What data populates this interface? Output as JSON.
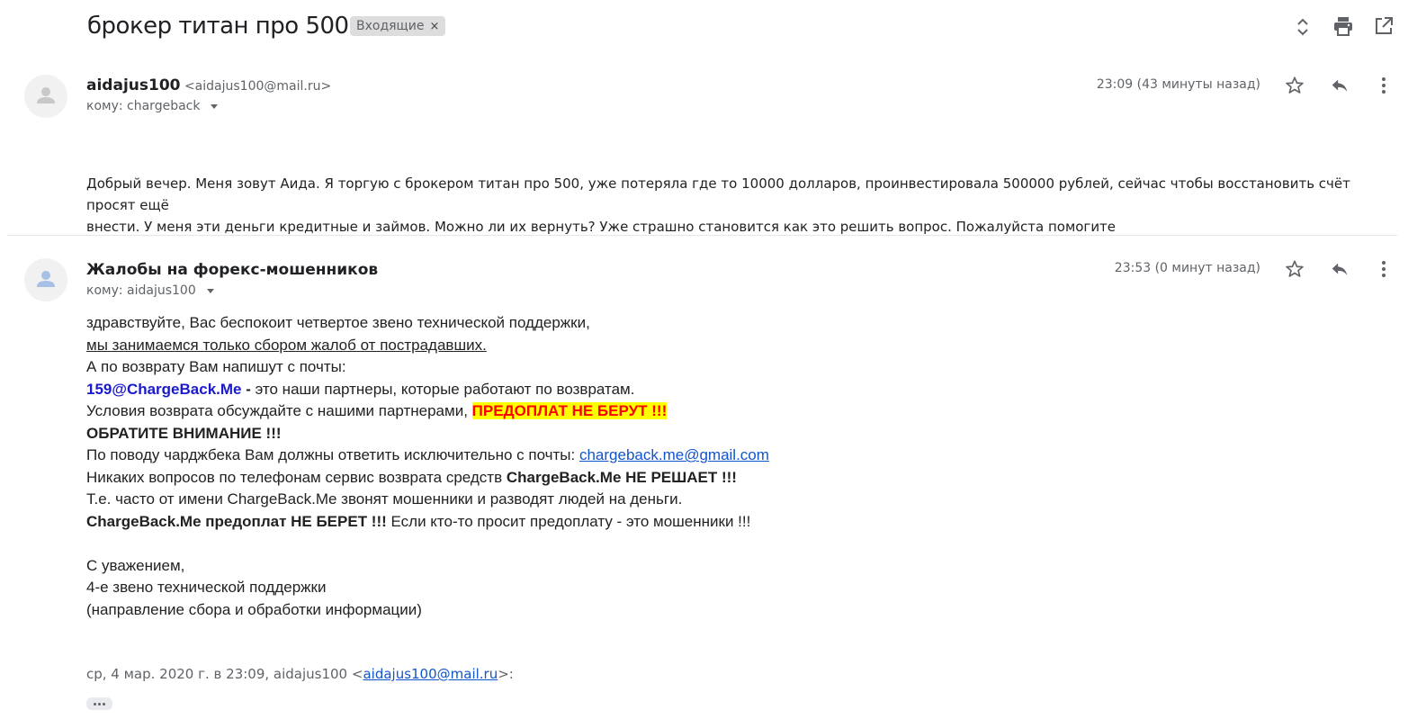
{
  "thread": {
    "subject": "брокер титан про 500",
    "label": "Входящие",
    "label_close": "×"
  },
  "header_icons": [
    "expand-collapse-icon",
    "print-icon",
    "open-in-new-window-icon"
  ],
  "messages": [
    {
      "sender_name": "aidajus100",
      "sender_email": "<aidajus100@mail.ru>",
      "to": "кому: chargeback",
      "time": "23:09 (43 минуты назад)",
      "body_line1": "Добрый вечер. Меня зовут Аида. Я торгую с брокером титан про 500, уже потеряла где то 10000 долларов, проинвестировала 500000 рублей, сейчас чтобы восстановить счёт просят ещё",
      "body_line2": "внести. У меня эти деньги кредитные и займов. Можно ли их вернуть?  Уже страшно становится как это решить вопрос. Пожалуйста помогите"
    },
    {
      "sender_name": "Жалобы на форекс-мошенников",
      "sender_email": "",
      "to": "кому: aidajus100",
      "time": "23:53 (0 минут назад)",
      "lines": {
        "l1": "здравствуйте, Вас беспокоит четвертое звено технической поддержки,",
        "l2": "мы занимаемся только сбором жалоб от пострадавших.",
        "l3": "А по возврату Вам напишут с почты:",
        "l4_email": "159@ChargeBack.Me",
        "l4_dash": " - ",
        "l4_rest": "это наши партнеры, которые работают по возвратам.",
        "l5_a": "Условия возврата обсуждайте с нашими партнерами, ",
        "l5_hl": "ПРЕДОПЛАТ НЕ БЕРУТ !!!",
        "l6": "ОБРАТИТЕ ВНИМАНИЕ !!!",
        "l7_a": "По поводу чарджбека Вам должны ответить исключительно с почты: ",
        "l7_link": "chargeback.me@gmail.com",
        "l8_a": "Никаких вопросов по телефонам сервис возврата средств ",
        "l8_b": "ChargeBack.Me НЕ РЕШАЕТ !!!",
        "l9": "Т.е. часто от имени ChargeBack.Me звонят мошенники и разводят людей на деньги.",
        "l10_b": "ChargeBack.Me предоплат НЕ БЕРЕТ !!!",
        "l10_a": " Если кто-то просит предоплату - это мошенники !!!",
        "sig1": "С уважением,",
        "sig2": "4-е звено технической поддержки",
        "sig3": "(направление сбора и обработки информации)"
      },
      "quote_prefix": "ср, 4 мар. 2020 г. в 23:09, aidajus100 <",
      "quote_email": "aidajus100@mail.ru",
      "quote_suffix": ">:"
    }
  ],
  "colors": {
    "highlight_bg": "#ffff00",
    "highlight_text": "#ff0000",
    "email_blue": "#1a1acc",
    "link": "#1155cc"
  }
}
